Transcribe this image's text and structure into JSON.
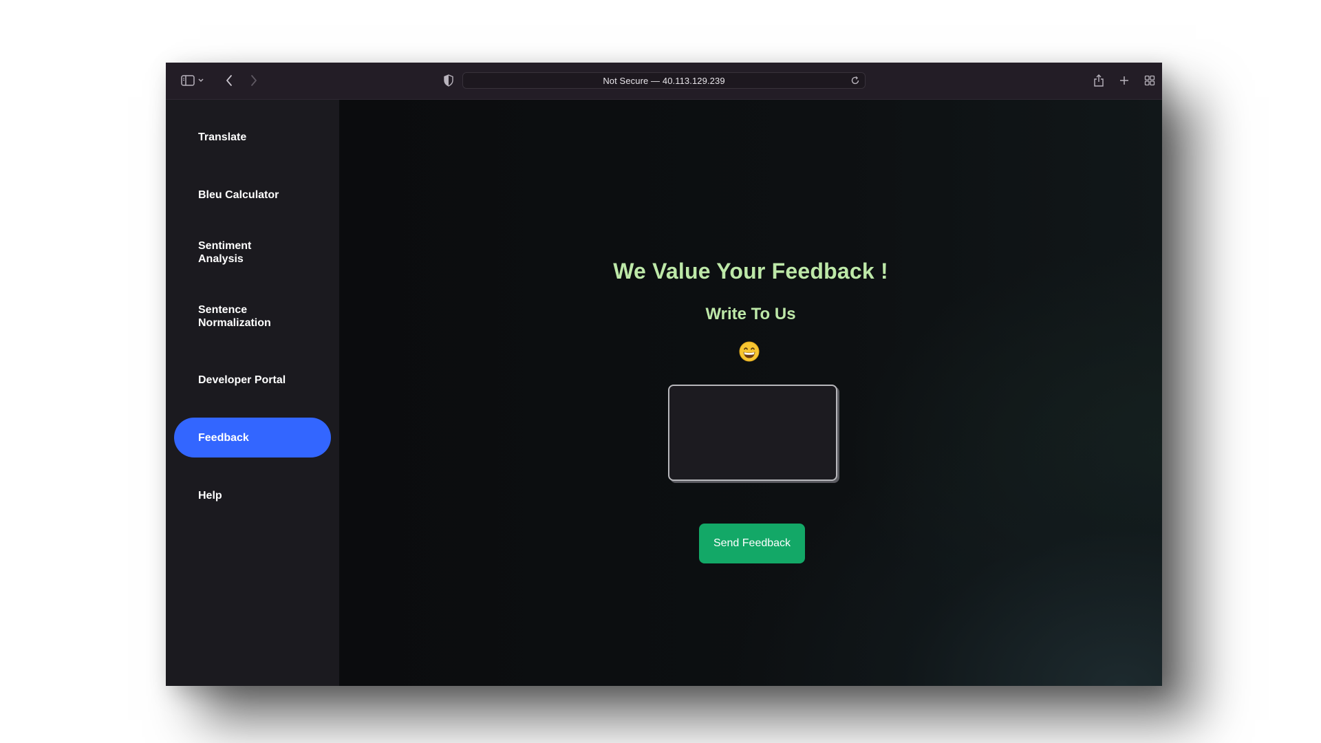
{
  "browser": {
    "url_text": "Not Secure — 40.113.129.239",
    "icons": [
      "sidebar-toggle-icon",
      "chevron-down-icon",
      "back-arrow-icon",
      "forward-arrow-icon",
      "shield-icon",
      "reload-icon",
      "share-icon",
      "new-tab-plus-icon",
      "tab-overview-icon"
    ]
  },
  "sidebar": {
    "items": [
      {
        "label": "Translate",
        "active": false
      },
      {
        "label": "Bleu Calculator",
        "active": false
      },
      {
        "label": "Sentiment Analysis",
        "active": false
      },
      {
        "label": "Sentence Normalization",
        "active": false
      },
      {
        "label": "Developer Portal",
        "active": false
      },
      {
        "label": "Feedback",
        "active": true
      },
      {
        "label": "Help",
        "active": false
      }
    ]
  },
  "main": {
    "heading": "We Value Your Feedback !",
    "subheading": "Write To Us",
    "emoji_icon": "grinning-face-emoji-icon",
    "feedback_value": "",
    "send_button_label": "Send Feedback"
  },
  "colors": {
    "toolbar": "#231d26",
    "sidebar": "#1b1a1f",
    "active_nav": "#3366ff",
    "heading": "#bde8a8",
    "send_button": "#13a867"
  }
}
